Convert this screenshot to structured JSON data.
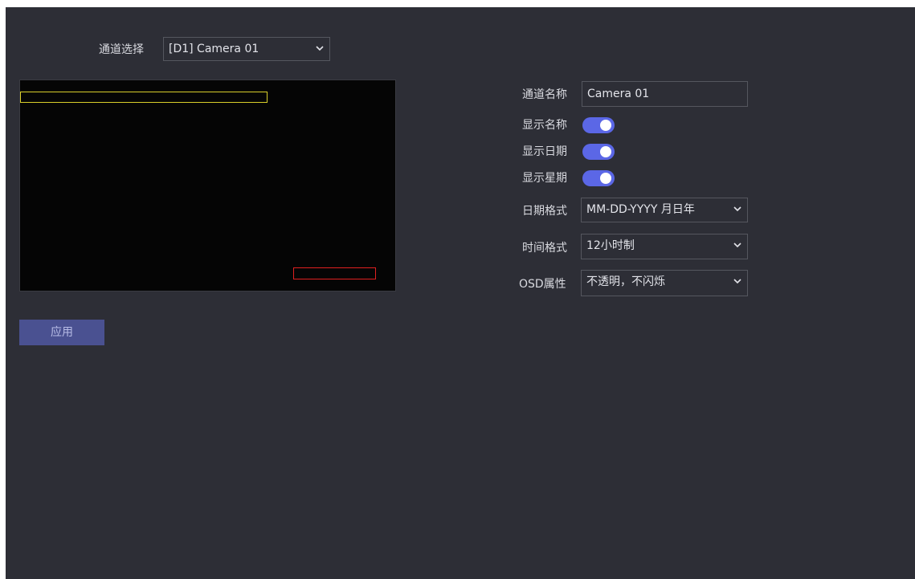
{
  "channel_select": {
    "label": "通道选择",
    "value": "[D1] Camera 01"
  },
  "settings": {
    "channel_name_label": "通道名称",
    "channel_name_value": "Camera 01",
    "show_name_label": "显示名称",
    "show_name_on": true,
    "show_date_label": "显示日期",
    "show_date_on": true,
    "show_week_label": "显示星期",
    "show_week_on": true,
    "date_format_label": "日期格式",
    "date_format_value": "MM-DD-YYYY 月日年",
    "time_format_label": "时间格式",
    "time_format_value": "12小时制",
    "osd_attr_label": "OSD属性",
    "osd_attr_value": "不透明，不闪烁"
  },
  "apply_label": "应用",
  "colors": {
    "background": "#2d2e36",
    "toggle_on": "#5b67e6",
    "osd_name_box": "#d9cf2a",
    "osd_date_box": "#e02020",
    "apply_button": "#4a5191"
  },
  "icons": {
    "dropdown": "chevron-down-icon"
  }
}
